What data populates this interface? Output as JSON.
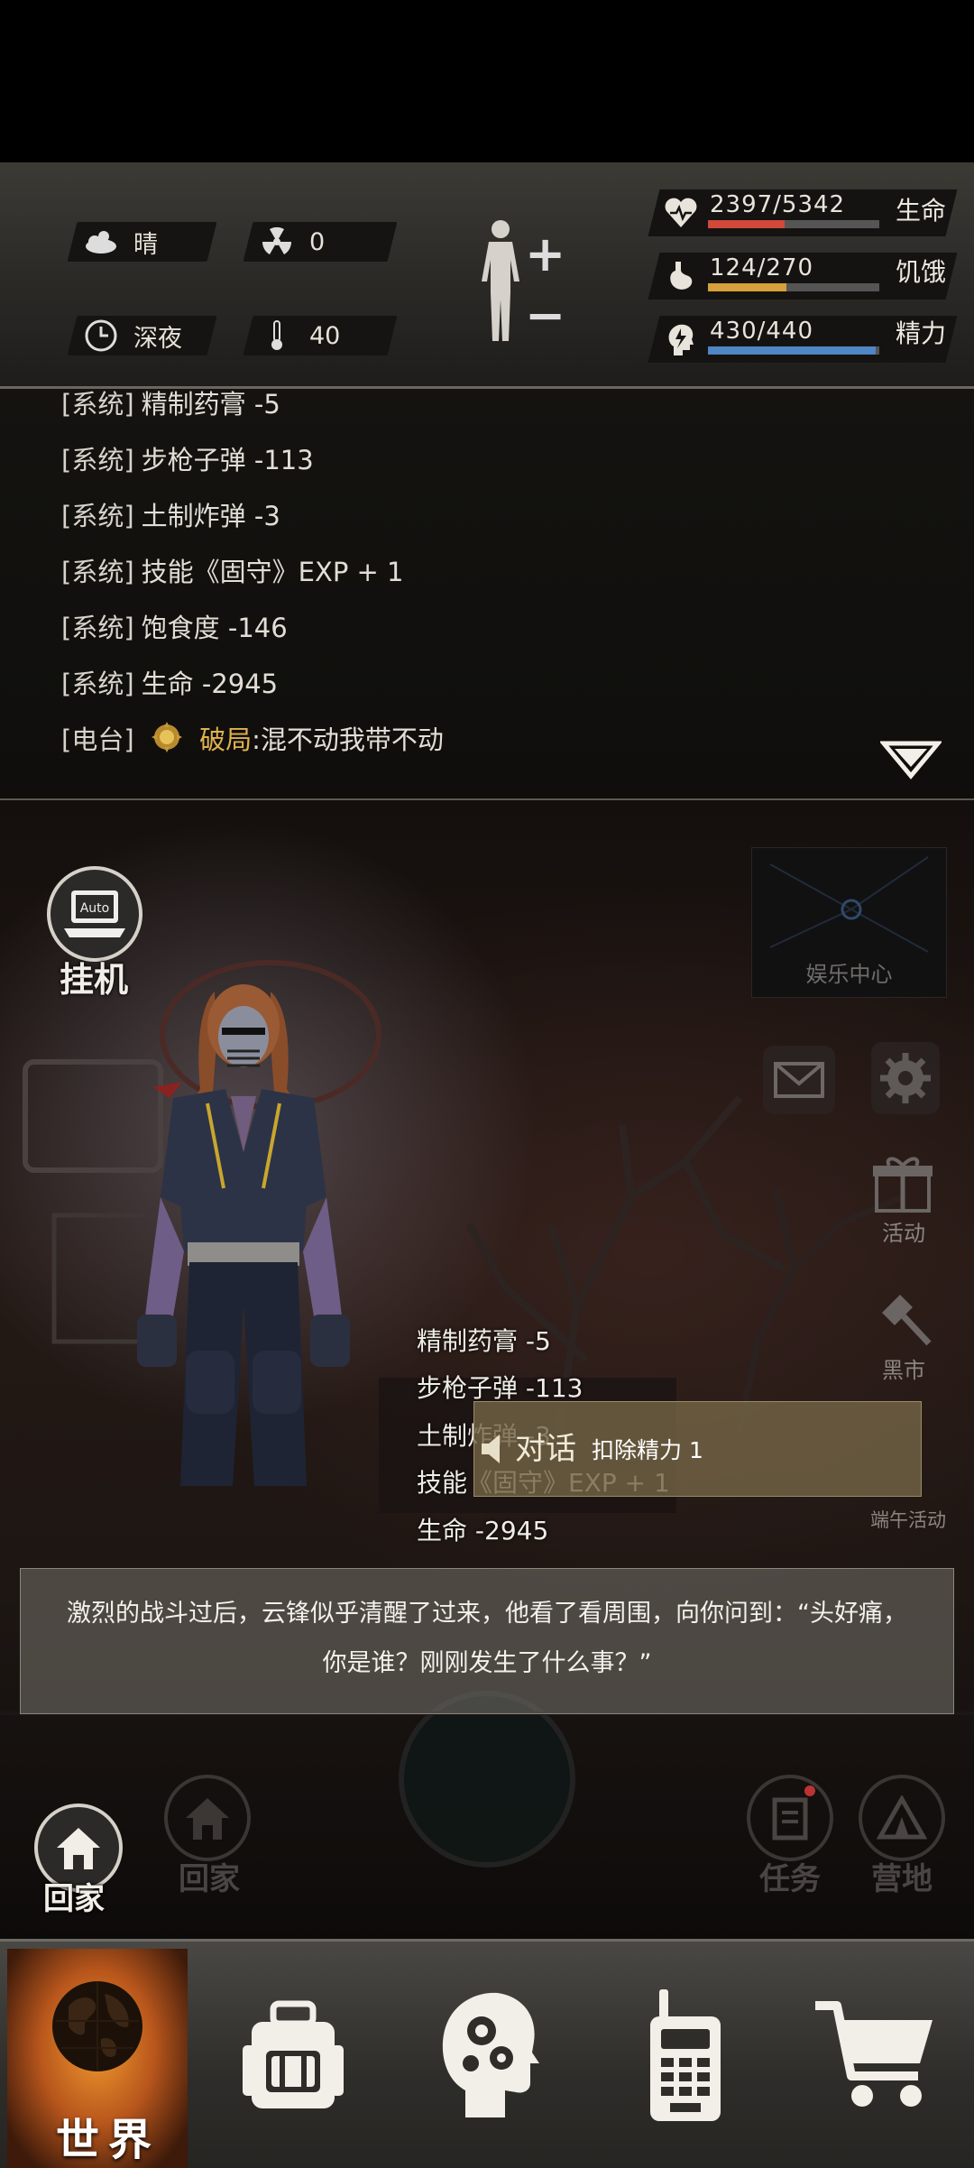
{
  "status": {
    "weather": "晴",
    "radiation": "0",
    "time_of_day": "深夜",
    "temperature": "40",
    "body_plus": "+",
    "body_minus": "−",
    "vitals": [
      {
        "label": "生命",
        "value": "2397/5342",
        "fraction": 0.449,
        "color": "#d2483b",
        "icon": "heart-icon"
      },
      {
        "label": "饥饿",
        "value": "124/270",
        "fraction": 0.459,
        "color": "#d6a03a",
        "icon": "stomach-icon"
      },
      {
        "label": "精力",
        "value": "430/440",
        "fraction": 0.977,
        "color": "#4f86c4",
        "icon": "head-energy-icon"
      }
    ]
  },
  "log": {
    "lines": [
      {
        "prefix": "[系统]",
        "text": "精制药膏 -5"
      },
      {
        "prefix": "[系统]",
        "text": "步枪子弹 -113"
      },
      {
        "prefix": "[系统]",
        "text": "土制炸弹 -3"
      },
      {
        "prefix": "[系统]",
        "text": "技能《固守》EXP + 1"
      },
      {
        "prefix": "[系统]",
        "text": "饱食度 -146"
      },
      {
        "prefix": "[系统]",
        "text": "生命 -2945"
      }
    ],
    "radio": {
      "prefix": "[电台]",
      "name": "破局",
      "message": ":混不动我带不动"
    }
  },
  "scene": {
    "auto_label": "Auto",
    "idle_label": "挂机",
    "entertainment_label": "娱乐中心",
    "activity_label": "活动",
    "black_market_label": "黑市",
    "dragon_boat_label": "端午活动",
    "float_lines": [
      "精制药膏 -5",
      "步枪子弹 -113",
      "土制炸弹 -3",
      "技能《固守》EXP + 1",
      "生命 -2945"
    ],
    "dialog_button": {
      "label": "对话",
      "cost": "扣除精力 1"
    },
    "story_text": "激烈的战斗过后，云锋似乎清醒了过来，他看了看周围，向你问到：“头好痛，你是谁？刚刚发生了什么事？”",
    "home_label": "回家",
    "home_label_dim": "回家",
    "task_label": "任务",
    "camp_label": "营地"
  },
  "nav": {
    "world_label": "世界"
  }
}
